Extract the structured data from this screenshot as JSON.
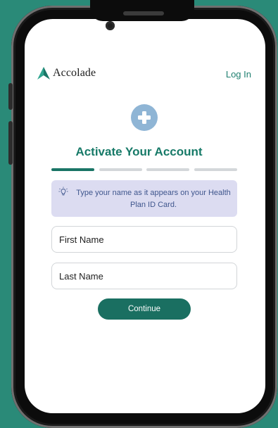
{
  "header": {
    "brand_name": "Accolade",
    "login_label": "Log In"
  },
  "page": {
    "title": "Activate Your Account",
    "progress": {
      "current_step": 1,
      "total_steps": 4
    }
  },
  "hint": {
    "text": "Type your name as it appears on your Health Plan ID Card.",
    "icon": "lightbulb-icon"
  },
  "form": {
    "first_name": {
      "placeholder": "First Name",
      "value": ""
    },
    "last_name": {
      "placeholder": "Last Name",
      "value": ""
    },
    "continue_label": "Continue"
  },
  "colors": {
    "background": "#2a8a78",
    "accent": "#1a7566",
    "title": "#177a68",
    "hint_background": "#dcdcf1",
    "hint_text": "#3f568d",
    "plus_circle": "#8fb5d5"
  },
  "icons": {
    "brand_logo": "accolade-logo-icon",
    "step_icon": "plus-icon"
  }
}
